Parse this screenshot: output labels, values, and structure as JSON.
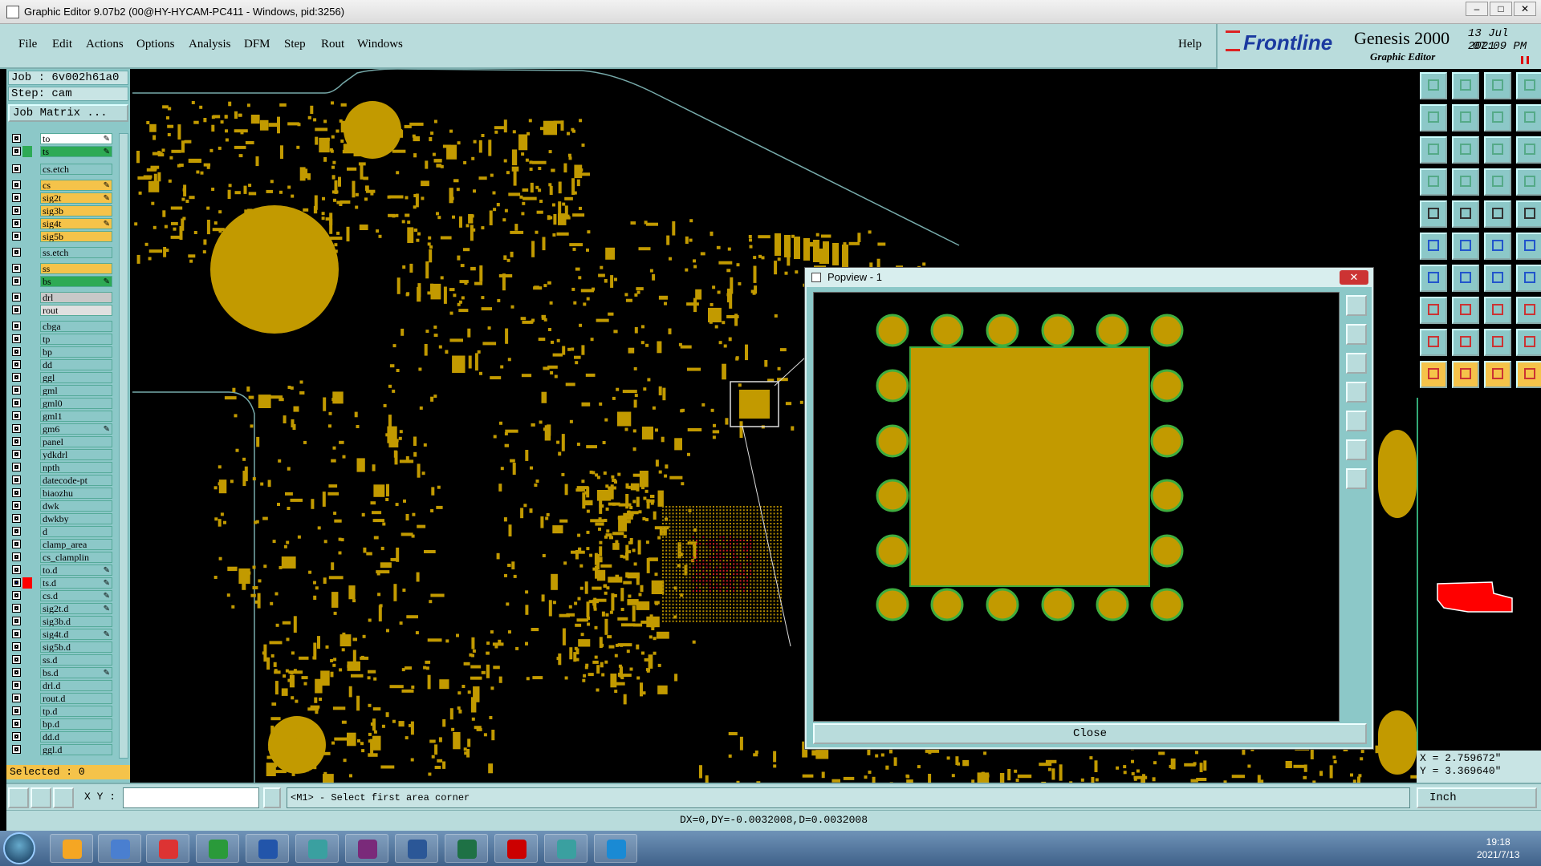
{
  "window": {
    "title": "Graphic Editor 9.07b2 (00@HY-HYCAM-PC411 - Windows, pid:3256)",
    "min": "–",
    "max": "□",
    "close": "✕"
  },
  "menu": [
    "File",
    "Edit",
    "Actions",
    "Options",
    "Analysis",
    "DFM",
    "Step",
    "Rout",
    "Windows"
  ],
  "help_label": "Help",
  "brand": {
    "logo": "Frontline",
    "product": "Genesis 2000",
    "subtitle": "Graphic Editor",
    "date": "13 Jul 2021",
    "time": "07:09 PM"
  },
  "job": {
    "job_line": "Job : 6v002h61a0",
    "step_line": "Step: cam",
    "matrix_button": "Job Matrix ..."
  },
  "layers": [
    {
      "name": "to",
      "color": "#ffffff",
      "edit": true
    },
    {
      "name": "ts",
      "color": "#2eaa55",
      "edit": true
    },
    {
      "name": "cs.etch",
      "color": "#8cc8c8",
      "edit": false
    },
    {
      "name": "cs",
      "color": "#f5c34a",
      "edit": true
    },
    {
      "name": "sig2t",
      "color": "#f5c34a",
      "edit": true
    },
    {
      "name": "sig3b",
      "color": "#f5c34a",
      "edit": false
    },
    {
      "name": "sig4t",
      "color": "#f5c34a",
      "edit": true
    },
    {
      "name": "sig5b",
      "color": "#f5c34a",
      "edit": false
    },
    {
      "name": "ss.etch",
      "color": "#8cc8c8",
      "edit": false
    },
    {
      "name": "ss",
      "color": "#f5c34a",
      "edit": false
    },
    {
      "name": "bs",
      "color": "#2eaa55",
      "edit": true
    },
    {
      "name": "drl",
      "color": "#c8c8c8",
      "edit": false
    },
    {
      "name": "rout",
      "color": "#e0e0e0",
      "edit": false
    },
    {
      "name": "cbga",
      "color": "#8cc8c8",
      "edit": false
    },
    {
      "name": "tp",
      "color": "#8cc8c8",
      "edit": false
    },
    {
      "name": "bp",
      "color": "#8cc8c8",
      "edit": false
    },
    {
      "name": "dd",
      "color": "#8cc8c8",
      "edit": false
    },
    {
      "name": "ggl",
      "color": "#8cc8c8",
      "edit": false
    },
    {
      "name": "gml",
      "color": "#8cc8c8",
      "edit": false
    },
    {
      "name": "gml0",
      "color": "#8cc8c8",
      "edit": false
    },
    {
      "name": "gml1",
      "color": "#8cc8c8",
      "edit": false
    },
    {
      "name": "gm6",
      "color": "#8cc8c8",
      "edit": true
    },
    {
      "name": "panel",
      "color": "#8cc8c8",
      "edit": false
    },
    {
      "name": "ydkdrl",
      "color": "#8cc8c8",
      "edit": false
    },
    {
      "name": "npth",
      "color": "#8cc8c8",
      "edit": false
    },
    {
      "name": "datecode-pt",
      "color": "#8cc8c8",
      "edit": false
    },
    {
      "name": "biaozhu",
      "color": "#8cc8c8",
      "edit": false
    },
    {
      "name": "dwk",
      "color": "#8cc8c8",
      "edit": false
    },
    {
      "name": "dwkby",
      "color": "#8cc8c8",
      "edit": false
    },
    {
      "name": "d",
      "color": "#8cc8c8",
      "edit": false
    },
    {
      "name": "clamp_area",
      "color": "#8cc8c8",
      "edit": false
    },
    {
      "name": "cs_clamplin",
      "color": "#8cc8c8",
      "edit": false
    },
    {
      "name": "to.d",
      "color": "#8cc8c8",
      "edit": true
    },
    {
      "name": "ts.d",
      "color": "#8cc8c8",
      "edit": true,
      "active": true
    },
    {
      "name": "cs.d",
      "color": "#8cc8c8",
      "edit": true
    },
    {
      "name": "sig2t.d",
      "color": "#8cc8c8",
      "edit": true
    },
    {
      "name": "sig3b.d",
      "color": "#8cc8c8",
      "edit": false
    },
    {
      "name": "sig4t.d",
      "color": "#8cc8c8",
      "edit": true
    },
    {
      "name": "sig5b.d",
      "color": "#8cc8c8",
      "edit": false
    },
    {
      "name": "ss.d",
      "color": "#8cc8c8",
      "edit": false
    },
    {
      "name": "bs.d",
      "color": "#8cc8c8",
      "edit": true
    },
    {
      "name": "drl.d",
      "color": "#8cc8c8",
      "edit": false
    },
    {
      "name": "rout.d",
      "color": "#8cc8c8",
      "edit": false
    },
    {
      "name": "tp.d",
      "color": "#8cc8c8",
      "edit": false
    },
    {
      "name": "bp.d",
      "color": "#8cc8c8",
      "edit": false
    },
    {
      "name": "dd.d",
      "color": "#8cc8c8",
      "edit": false
    },
    {
      "name": "ggl.d",
      "color": "#8cc8c8",
      "edit": false
    }
  ],
  "selected": "Selected : 0",
  "command": {
    "xy_label": "X Y :",
    "input_value": "",
    "prompt": "<M1> - Select first area corner",
    "units": "Inch"
  },
  "status": "DX=0,DY=-0.0032008,D=0.0032008",
  "coords": {
    "x": "X = 2.759672\"",
    "y": "Y = 3.369640\""
  },
  "popview": {
    "title": "Popview - 1",
    "close_label": "Close"
  },
  "taskbar": {
    "time": "19:18",
    "date": "2021/7/13"
  },
  "colors": {
    "pad": "#c29a00",
    "pad_ring": "#3fae3f",
    "panel": "#8cc8c8",
    "highlight": "#f5c34a"
  }
}
